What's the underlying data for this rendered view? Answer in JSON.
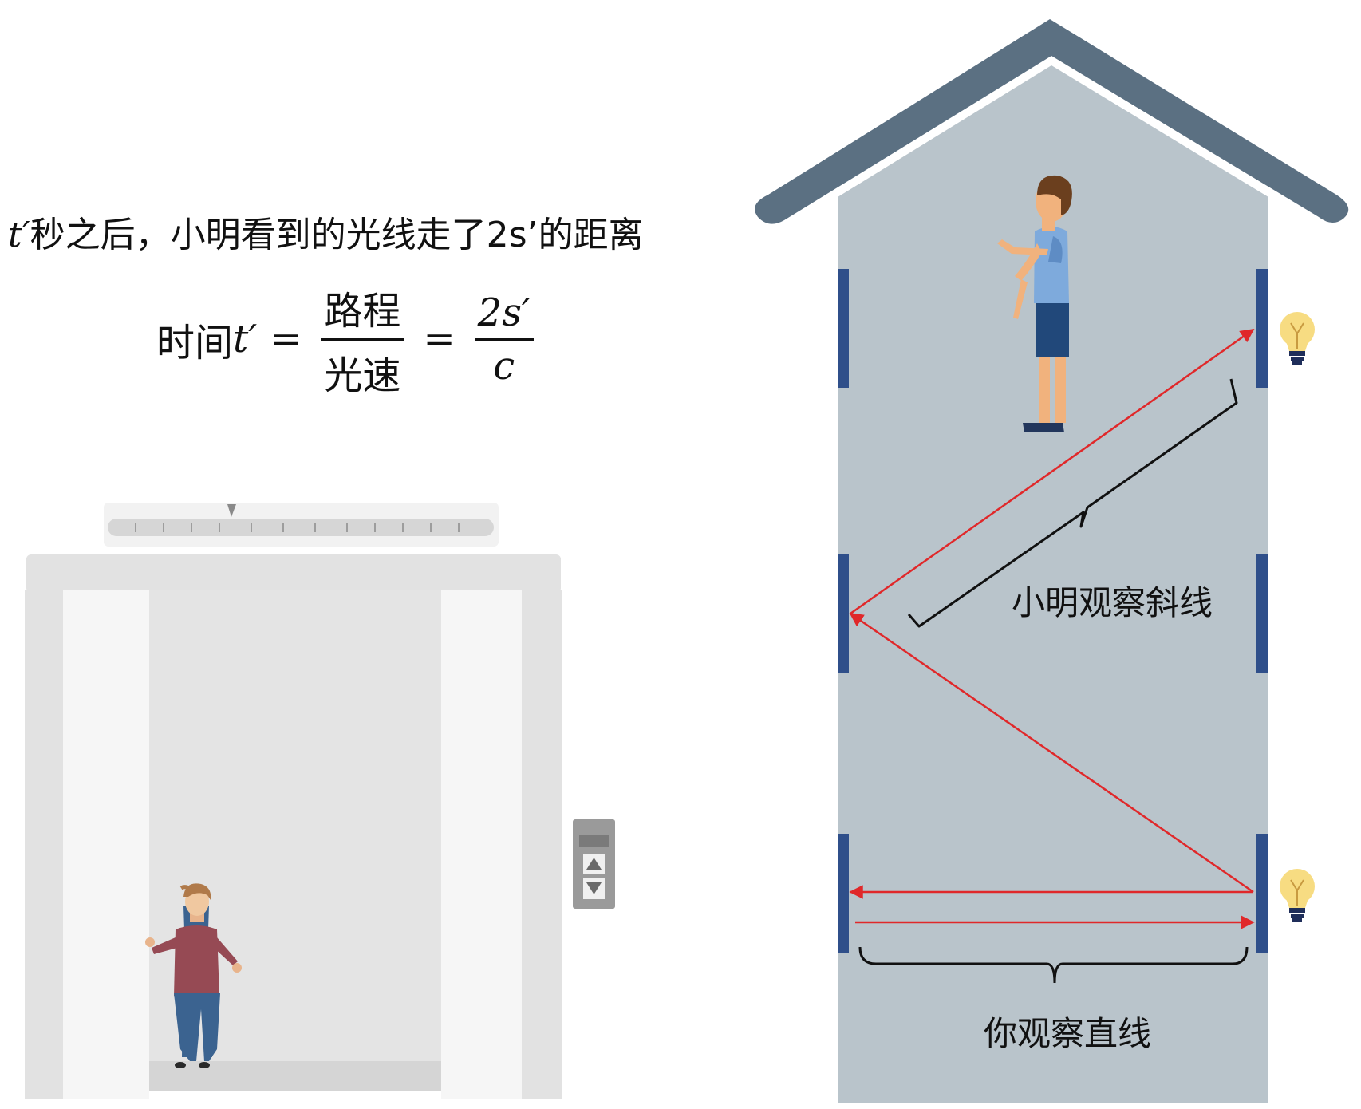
{
  "text": {
    "sentence_var": "t′",
    "sentence_rest": "秒之后，小明看到的光线走了2s’的距离",
    "formula_time": "时间",
    "formula_t": "t′",
    "formula_eq": "=",
    "formula_num_left": "路程",
    "formula_den_left": "光速",
    "formula_num_right": "2s′",
    "formula_den_right": "c",
    "label_diagonal": "小明观察斜线",
    "label_straight": "你观察直线"
  },
  "icons": [
    "lightbulb-icon",
    "elevator-call-button-icon",
    "up-arrow-icon",
    "down-arrow-icon"
  ],
  "colors": {
    "roof": "#5b7082",
    "shaft": "#b9c4cb",
    "mirror": "#2f4f8a",
    "light_ray": "#e0282a",
    "bracket": "#111111"
  }
}
